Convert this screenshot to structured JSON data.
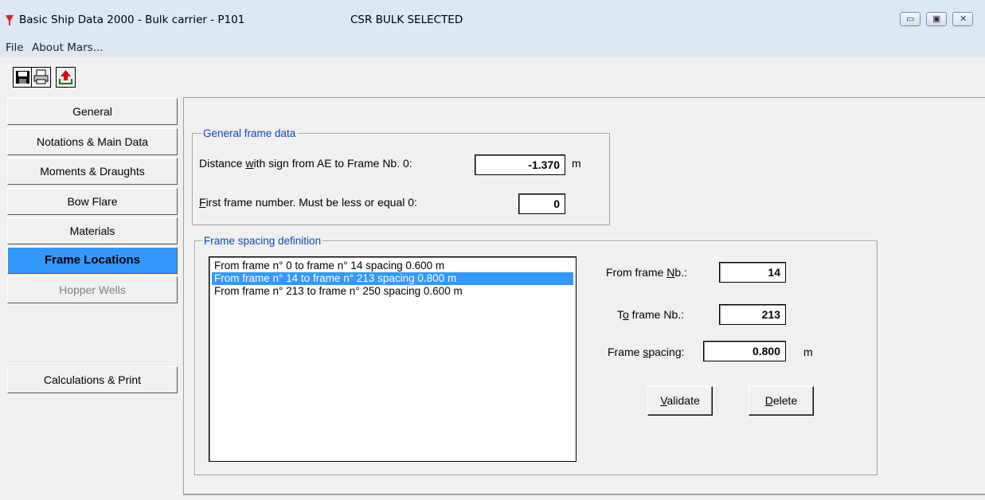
{
  "window": {
    "title": "Basic Ship Data 2000 - Bulk carrier - P101",
    "title_extra": "CSR BULK SELECTED",
    "controls": {
      "minimize": "▭",
      "maximize": "▣",
      "close": "✕"
    }
  },
  "menu": {
    "file": "File",
    "about": "About Mars..."
  },
  "toolbar": {
    "icons": [
      "save-icon",
      "print-icon",
      "export-icon"
    ]
  },
  "nav": {
    "general": "General",
    "notations": "Notations & Main Data",
    "moments": "Moments & Draughts",
    "bowflare": "Bow Flare",
    "materials": "Materials",
    "frame_locations": "Frame Locations",
    "hopper_wells": "Hopper Wells",
    "calc_print": "Calculations & Print"
  },
  "general_frame": {
    "title": "General frame data",
    "distance_pre": "Distance ",
    "distance_u": "w",
    "distance_post": "ith sign from AE to Frame Nb. 0:",
    "distance_value": "-1.370",
    "distance_unit": "m",
    "first_u": "F",
    "first_post": "irst frame number. Must be less or equal 0:",
    "first_value": "0"
  },
  "frame_spacing": {
    "title": "Frame spacing definition",
    "items": [
      "From frame n° 0 to frame n° 14 spacing 0.600 m",
      "From frame n° 14 to frame n° 213 spacing 0.800 m",
      "From frame n° 213 to frame n° 250 spacing 0.600 m"
    ],
    "from_pre": "From frame ",
    "from_u": "N",
    "from_post": "b.:",
    "from_value": "14",
    "to_pre": "T",
    "to_u": "o",
    "to_post": " frame Nb.:",
    "to_value": "213",
    "spacing_pre": "Frame ",
    "spacing_u": "s",
    "spacing_post": "pacing:",
    "spacing_value": "0.800",
    "spacing_unit": "m",
    "validate_u": "V",
    "validate_post": "alidate",
    "delete_u": "D",
    "delete_post": "elete"
  },
  "colors": {
    "accent": "#3399ff",
    "group_title": "#0a47c4"
  }
}
